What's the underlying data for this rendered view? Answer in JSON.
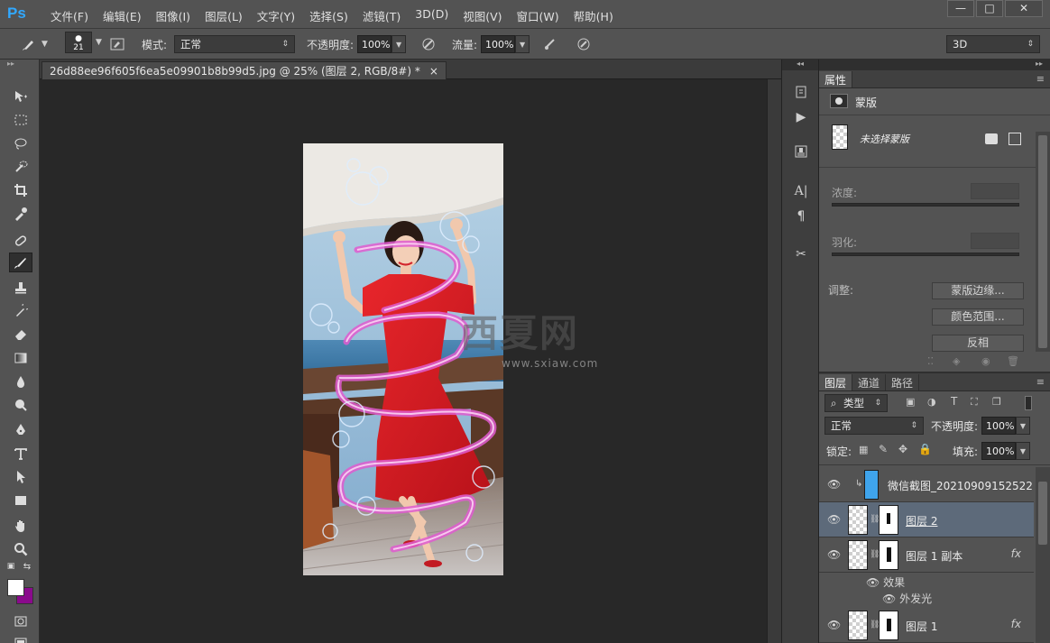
{
  "app": {
    "logo": "Ps"
  },
  "menu": [
    "文件(F)",
    "编辑(E)",
    "图像(I)",
    "图层(L)",
    "文字(Y)",
    "选择(S)",
    "滤镜(T)",
    "3D(D)",
    "视图(V)",
    "窗口(W)",
    "帮助(H)"
  ],
  "window_controls": {
    "minimize": "—",
    "maximize": "□",
    "close": "✕"
  },
  "options": {
    "brush_size": "21",
    "mode_label": "模式:",
    "mode_value": "正常",
    "opacity_label": "不透明度:",
    "opacity_value": "100%",
    "flow_label": "流量:",
    "flow_value": "100%",
    "workspace": "3D"
  },
  "document": {
    "tab_title": "26d88ee96f605f6ea5e09901b8b99d5.jpg @ 25% (图层 2, RGB/8#) *",
    "close": "×"
  },
  "watermark": {
    "big": "西夏网",
    "small": "www.sxiaw.com"
  },
  "properties": {
    "tab": "属性",
    "type_label": "蒙版",
    "no_mask_text": "未选择蒙版",
    "density_label": "浓度:",
    "feather_label": "羽化:",
    "adjust_label": "调整:",
    "btn_mask_edge": "蒙版边缘...",
    "btn_color_range": "颜色范围...",
    "btn_invert": "反相"
  },
  "layers_panel": {
    "tabs": [
      "图层",
      "通道",
      "路径"
    ],
    "filter_kind": "类型",
    "blend_mode": "正常",
    "opacity_label": "不透明度:",
    "opacity_value": "100%",
    "lock_label": "锁定:",
    "fill_label": "填充:",
    "fill_value": "100%",
    "layers": [
      {
        "name": "微信截图_20210909152522",
        "visible": true,
        "fx": false
      },
      {
        "name": "图层 2",
        "visible": true,
        "fx": false,
        "selected": true
      },
      {
        "name": "图层 1 副本",
        "visible": true,
        "fx": true
      },
      {
        "name": "图层 1",
        "visible": true,
        "fx": true
      }
    ],
    "effects_label": "效果",
    "outer_glow_label": "外发光",
    "fx_symbol": "fx"
  },
  "colors": {
    "foreground": "#ffffff",
    "background": "#8a0a8c",
    "accent": "#31a8ff"
  }
}
